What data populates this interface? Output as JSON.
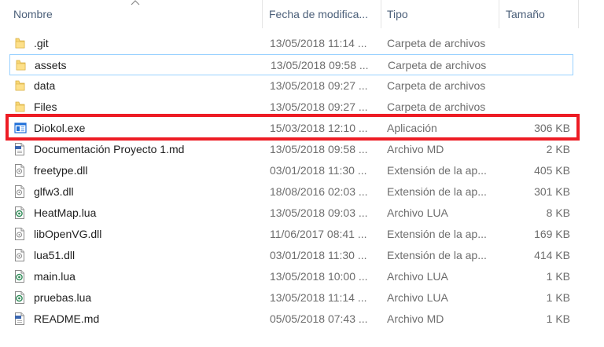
{
  "columns": {
    "name": "Nombre",
    "date": "Fecha de modifica...",
    "type": "Tipo",
    "size": "Tamaño"
  },
  "colors": {
    "highlight": "#ed1c24",
    "folder": "#f8d775",
    "lua": "#2e8b57",
    "md_badge": "#3a66b0",
    "exe": "#1e6fd9"
  },
  "files": [
    {
      "name": ".git",
      "date": "13/05/2018 11:14 ...",
      "type": "Carpeta de archivos",
      "size": "",
      "icon": "folder-icon"
    },
    {
      "name": "assets",
      "date": "13/05/2018 09:58 ...",
      "type": "Carpeta de archivos",
      "size": "",
      "icon": "folder-icon"
    },
    {
      "name": "data",
      "date": "13/05/2018 09:27 ...",
      "type": "Carpeta de archivos",
      "size": "",
      "icon": "folder-icon"
    },
    {
      "name": "Files",
      "date": "13/05/2018 09:27 ...",
      "type": "Carpeta de archivos",
      "size": "",
      "icon": "folder-icon"
    },
    {
      "name": "Diokol.exe",
      "date": "15/03/2018 12:10 ...",
      "type": "Aplicación",
      "size": "306 KB",
      "icon": "exe-icon"
    },
    {
      "name": "Documentación Proyecto 1.md",
      "date": "13/05/2018 09:58 ...",
      "type": "Archivo MD",
      "size": "2 KB",
      "icon": "md-file-icon"
    },
    {
      "name": "freetype.dll",
      "date": "03/01/2018 11:30 ...",
      "type": "Extensión de la ap...",
      "size": "405 KB",
      "icon": "dll-file-icon"
    },
    {
      "name": "glfw3.dll",
      "date": "18/08/2016 02:03 ...",
      "type": "Extensión de la ap...",
      "size": "301 KB",
      "icon": "dll-file-icon"
    },
    {
      "name": "HeatMap.lua",
      "date": "13/05/2018 09:03 ...",
      "type": "Archivo LUA",
      "size": "8 KB",
      "icon": "lua-file-icon"
    },
    {
      "name": "libOpenVG.dll",
      "date": "11/06/2017 08:41 ...",
      "type": "Extensión de la ap...",
      "size": "169 KB",
      "icon": "dll-file-icon"
    },
    {
      "name": "lua51.dll",
      "date": "03/01/2018 11:30 ...",
      "type": "Extensión de la ap...",
      "size": "414 KB",
      "icon": "dll-file-icon"
    },
    {
      "name": "main.lua",
      "date": "13/05/2018 10:00 ...",
      "type": "Archivo LUA",
      "size": "1 KB",
      "icon": "lua-file-icon"
    },
    {
      "name": "pruebas.lua",
      "date": "13/05/2018 11:14 ...",
      "type": "Archivo LUA",
      "size": "1 KB",
      "icon": "lua-file-icon"
    },
    {
      "name": "README.md",
      "date": "05/05/2018 07:43 ...",
      "type": "Archivo MD",
      "size": "1 KB",
      "icon": "md-file-icon"
    }
  ]
}
